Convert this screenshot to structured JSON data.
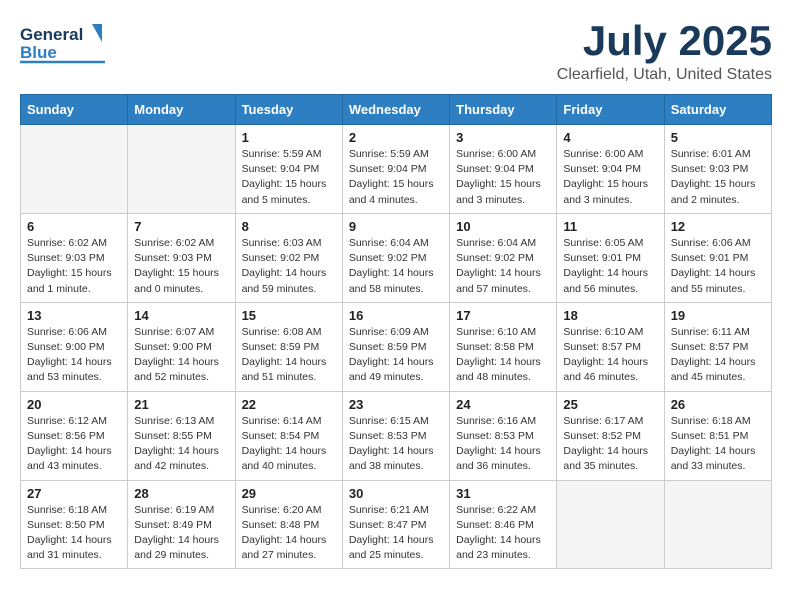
{
  "header": {
    "logo_line1": "General",
    "logo_line2": "Blue",
    "month": "July 2025",
    "location": "Clearfield, Utah, United States"
  },
  "weekdays": [
    "Sunday",
    "Monday",
    "Tuesday",
    "Wednesday",
    "Thursday",
    "Friday",
    "Saturday"
  ],
  "weeks": [
    [
      {
        "day": "",
        "info": ""
      },
      {
        "day": "",
        "info": ""
      },
      {
        "day": "1",
        "info": "Sunrise: 5:59 AM\nSunset: 9:04 PM\nDaylight: 15 hours\nand 5 minutes."
      },
      {
        "day": "2",
        "info": "Sunrise: 5:59 AM\nSunset: 9:04 PM\nDaylight: 15 hours\nand 4 minutes."
      },
      {
        "day": "3",
        "info": "Sunrise: 6:00 AM\nSunset: 9:04 PM\nDaylight: 15 hours\nand 3 minutes."
      },
      {
        "day": "4",
        "info": "Sunrise: 6:00 AM\nSunset: 9:04 PM\nDaylight: 15 hours\nand 3 minutes."
      },
      {
        "day": "5",
        "info": "Sunrise: 6:01 AM\nSunset: 9:03 PM\nDaylight: 15 hours\nand 2 minutes."
      }
    ],
    [
      {
        "day": "6",
        "info": "Sunrise: 6:02 AM\nSunset: 9:03 PM\nDaylight: 15 hours\nand 1 minute."
      },
      {
        "day": "7",
        "info": "Sunrise: 6:02 AM\nSunset: 9:03 PM\nDaylight: 15 hours\nand 0 minutes."
      },
      {
        "day": "8",
        "info": "Sunrise: 6:03 AM\nSunset: 9:02 PM\nDaylight: 14 hours\nand 59 minutes."
      },
      {
        "day": "9",
        "info": "Sunrise: 6:04 AM\nSunset: 9:02 PM\nDaylight: 14 hours\nand 58 minutes."
      },
      {
        "day": "10",
        "info": "Sunrise: 6:04 AM\nSunset: 9:02 PM\nDaylight: 14 hours\nand 57 minutes."
      },
      {
        "day": "11",
        "info": "Sunrise: 6:05 AM\nSunset: 9:01 PM\nDaylight: 14 hours\nand 56 minutes."
      },
      {
        "day": "12",
        "info": "Sunrise: 6:06 AM\nSunset: 9:01 PM\nDaylight: 14 hours\nand 55 minutes."
      }
    ],
    [
      {
        "day": "13",
        "info": "Sunrise: 6:06 AM\nSunset: 9:00 PM\nDaylight: 14 hours\nand 53 minutes."
      },
      {
        "day": "14",
        "info": "Sunrise: 6:07 AM\nSunset: 9:00 PM\nDaylight: 14 hours\nand 52 minutes."
      },
      {
        "day": "15",
        "info": "Sunrise: 6:08 AM\nSunset: 8:59 PM\nDaylight: 14 hours\nand 51 minutes."
      },
      {
        "day": "16",
        "info": "Sunrise: 6:09 AM\nSunset: 8:59 PM\nDaylight: 14 hours\nand 49 minutes."
      },
      {
        "day": "17",
        "info": "Sunrise: 6:10 AM\nSunset: 8:58 PM\nDaylight: 14 hours\nand 48 minutes."
      },
      {
        "day": "18",
        "info": "Sunrise: 6:10 AM\nSunset: 8:57 PM\nDaylight: 14 hours\nand 46 minutes."
      },
      {
        "day": "19",
        "info": "Sunrise: 6:11 AM\nSunset: 8:57 PM\nDaylight: 14 hours\nand 45 minutes."
      }
    ],
    [
      {
        "day": "20",
        "info": "Sunrise: 6:12 AM\nSunset: 8:56 PM\nDaylight: 14 hours\nand 43 minutes."
      },
      {
        "day": "21",
        "info": "Sunrise: 6:13 AM\nSunset: 8:55 PM\nDaylight: 14 hours\nand 42 minutes."
      },
      {
        "day": "22",
        "info": "Sunrise: 6:14 AM\nSunset: 8:54 PM\nDaylight: 14 hours\nand 40 minutes."
      },
      {
        "day": "23",
        "info": "Sunrise: 6:15 AM\nSunset: 8:53 PM\nDaylight: 14 hours\nand 38 minutes."
      },
      {
        "day": "24",
        "info": "Sunrise: 6:16 AM\nSunset: 8:53 PM\nDaylight: 14 hours\nand 36 minutes."
      },
      {
        "day": "25",
        "info": "Sunrise: 6:17 AM\nSunset: 8:52 PM\nDaylight: 14 hours\nand 35 minutes."
      },
      {
        "day": "26",
        "info": "Sunrise: 6:18 AM\nSunset: 8:51 PM\nDaylight: 14 hours\nand 33 minutes."
      }
    ],
    [
      {
        "day": "27",
        "info": "Sunrise: 6:18 AM\nSunset: 8:50 PM\nDaylight: 14 hours\nand 31 minutes."
      },
      {
        "day": "28",
        "info": "Sunrise: 6:19 AM\nSunset: 8:49 PM\nDaylight: 14 hours\nand 29 minutes."
      },
      {
        "day": "29",
        "info": "Sunrise: 6:20 AM\nSunset: 8:48 PM\nDaylight: 14 hours\nand 27 minutes."
      },
      {
        "day": "30",
        "info": "Sunrise: 6:21 AM\nSunset: 8:47 PM\nDaylight: 14 hours\nand 25 minutes."
      },
      {
        "day": "31",
        "info": "Sunrise: 6:22 AM\nSunset: 8:46 PM\nDaylight: 14 hours\nand 23 minutes."
      },
      {
        "day": "",
        "info": ""
      },
      {
        "day": "",
        "info": ""
      }
    ]
  ]
}
